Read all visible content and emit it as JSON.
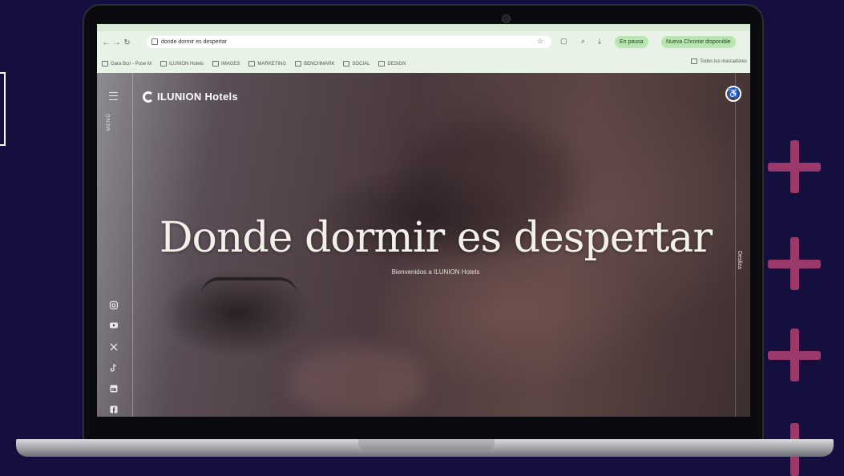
{
  "browser": {
    "url": "donde dormir es despertar",
    "pause_label": "En pausa",
    "update_label": "Nueva Chrome disponible",
    "bookmarks": [
      "Gara Bcn - Pose M",
      "ILUNION Hotels",
      "IMAGES",
      "MARKETING",
      "BENCHMARK",
      "SOCIAL",
      "DESIGN"
    ],
    "all_bookmarks_label": "Todos los marcadores"
  },
  "site": {
    "menu_label": "MENÚ",
    "logo_text": "ILUNION Hotels",
    "hero_title": "Donde dormir es despertar",
    "hero_subtitle": "Bienvenidos a ILUNION Hotels",
    "discover_label": "Desliza",
    "social_icons": [
      "instagram-icon",
      "youtube-icon",
      "x-icon",
      "tiktok-icon",
      "linkedin-icon",
      "facebook-icon"
    ]
  },
  "colors": {
    "background": "#150f3f",
    "accent_plus": "#9b3a6a",
    "chrome_bar": "#e9f2e6",
    "chip_green": "#b9e5b1"
  }
}
